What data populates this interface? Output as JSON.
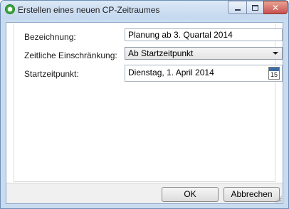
{
  "window": {
    "title": "Erstellen eines neuen CP-Zeitraumes"
  },
  "form": {
    "name_label": "Bezeichnung:",
    "name_value": "Planung ab 3. Quartal 2014",
    "restriction_label": "Zeitliche Einschränkung:",
    "restriction_value": "Ab Startzeitpunkt",
    "start_label": "Startzeitpunkt:",
    "start_value": "Dienstag, 1. April 2014",
    "calendar_day": "15"
  },
  "footer": {
    "ok_label": "OK",
    "cancel_label": "Abbrechen"
  },
  "icons": {
    "app": "app-logo-icon",
    "minimize": "minimize-icon",
    "maximize": "maximize-icon",
    "close": "close-icon",
    "calendar": "calendar-icon",
    "dropdown": "chevron-down-icon"
  },
  "colors": {
    "titlebar": "#c3d7ee",
    "close_button": "#c75050",
    "frame_border": "#6f8fb5"
  }
}
